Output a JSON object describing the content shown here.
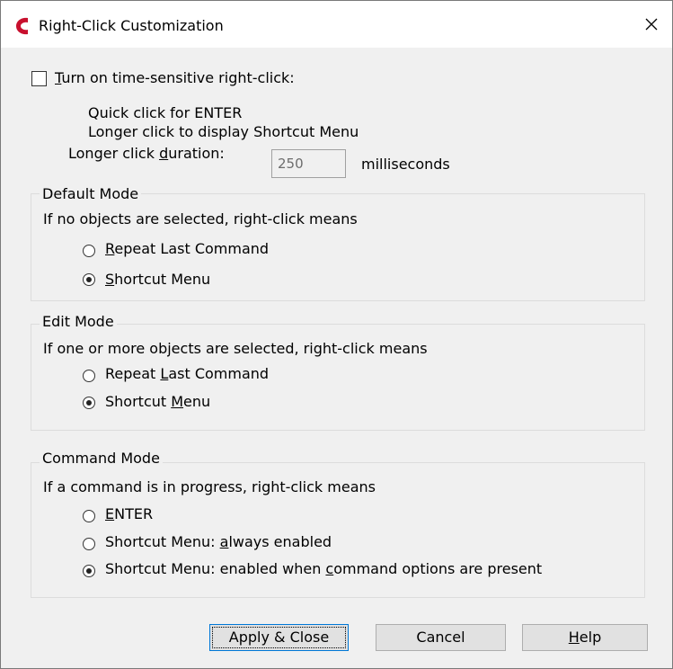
{
  "window": {
    "title": "Right-Click Customization"
  },
  "time_sensitive": {
    "checkbox_label": "Turn on time-sensitive right-click:",
    "checked": false,
    "line1": "Quick click for ENTER",
    "line2": "Longer click to display Shortcut Menu",
    "duration_label": "Longer click duration:",
    "duration_value": "250",
    "duration_unit": "milliseconds"
  },
  "default_mode": {
    "title": "Default Mode",
    "description": "If no objects are selected, right-click means",
    "options": [
      {
        "label": "Repeat Last Command",
        "checked": false
      },
      {
        "label": "Shortcut Menu",
        "checked": true
      }
    ]
  },
  "edit_mode": {
    "title": "Edit Mode",
    "description": "If one or more objects are selected, right-click means",
    "options": [
      {
        "label": "Repeat Last Command",
        "checked": false
      },
      {
        "label": "Shortcut Menu",
        "checked": true
      }
    ]
  },
  "command_mode": {
    "title": "Command Mode",
    "description": "If a command is in progress, right-click means",
    "options": [
      {
        "label": "ENTER",
        "checked": false
      },
      {
        "label": "Shortcut Menu: always enabled",
        "checked": false
      },
      {
        "label": "Shortcut Menu: enabled when command options are present",
        "checked": true
      }
    ]
  },
  "buttons": {
    "apply_close": "Apply & Close",
    "cancel": "Cancel",
    "help": "Help"
  },
  "colors": {
    "app_icon": "#c8102e",
    "default_button_border": "#0078d7"
  }
}
